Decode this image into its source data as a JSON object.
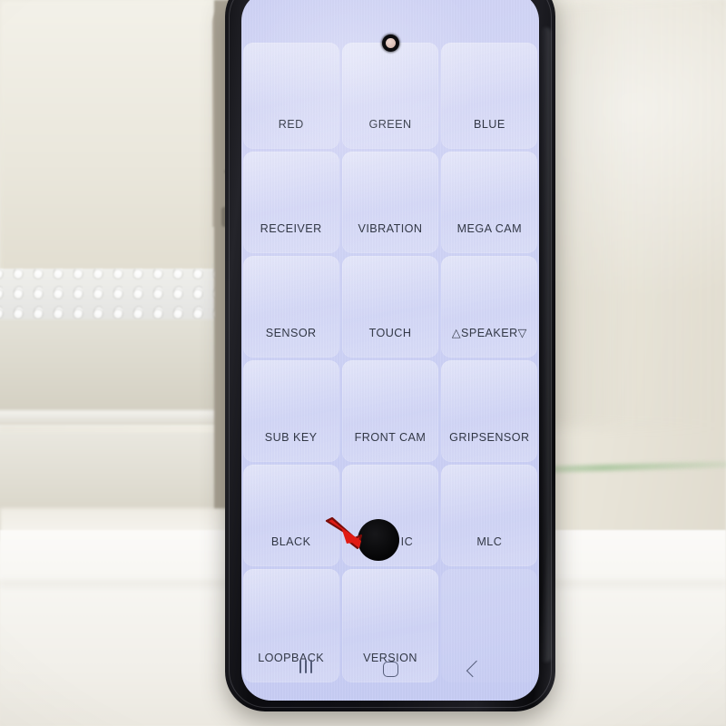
{
  "scene": {
    "description": "smartphone-diagnostic-screen-photo",
    "background_color": "#efece2",
    "surface": "styrofoam-block-and-white-table"
  },
  "phone": {
    "frame_color": "#121216",
    "screen_background_color": "#ccd1f5",
    "label_text_color": "#2f3543"
  },
  "camera": {
    "name": "front-punch-hole-camera"
  },
  "screen": {
    "title": "hardware-diagnostic-test-grid",
    "grid": {
      "columns": 3,
      "rows": [
        {
          "cells": [
            {
              "label": "RED",
              "blank": false
            },
            {
              "label": "GREEN",
              "blank": false
            },
            {
              "label": "BLUE",
              "blank": false
            }
          ]
        },
        {
          "cells": [
            {
              "label": "RECEIVER",
              "blank": false
            },
            {
              "label": "VIBRATION",
              "blank": false
            },
            {
              "label": "MEGA CAM",
              "blank": false
            }
          ]
        },
        {
          "cells": [
            {
              "label": "SENSOR",
              "blank": false
            },
            {
              "label": "TOUCH",
              "blank": false
            },
            {
              "label": "△SPEAKER▽",
              "blank": false
            }
          ]
        },
        {
          "cells": [
            {
              "label": "SUB KEY",
              "blank": false
            },
            {
              "label": "FRONT CAM",
              "blank": false
            },
            {
              "label": "GRIPSENSOR",
              "blank": false
            }
          ]
        },
        {
          "cells": [
            {
              "label": "BLACK",
              "blank": false
            },
            {
              "label": "HALL IC",
              "blank": false
            },
            {
              "label": "MLC",
              "blank": false
            }
          ]
        },
        {
          "cells": [
            {
              "label": "LOOPBACK",
              "blank": false
            },
            {
              "label": "VERSION",
              "blank": false
            },
            {
              "label": "",
              "blank": true
            }
          ]
        }
      ]
    }
  },
  "annotation": {
    "defect": {
      "name": "black-dot-display-defect",
      "color": "#0b0b0e"
    },
    "arrow": {
      "name": "red-pointer-arrow",
      "color": "#e01b14",
      "outline_color": "#7a0d09"
    }
  },
  "navigation_bar": {
    "icon_color": "#575f7c",
    "buttons": [
      {
        "name": "recents",
        "glyph": "|||"
      },
      {
        "name": "home",
        "glyph": "▢"
      },
      {
        "name": "back",
        "glyph": "‹"
      }
    ]
  }
}
